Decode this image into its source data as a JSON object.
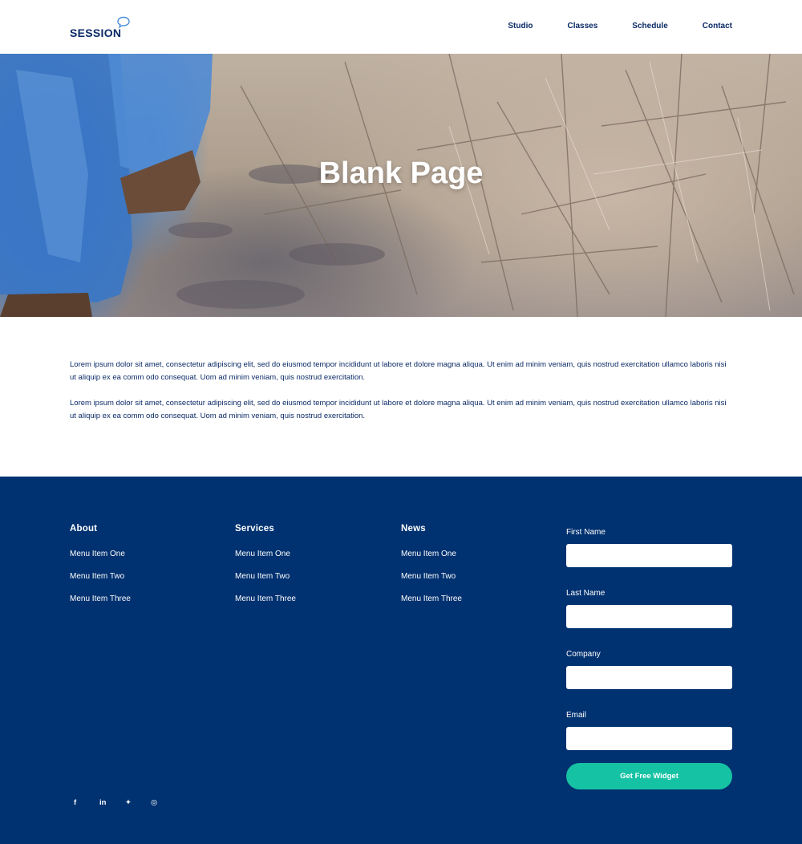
{
  "header": {
    "logo_text": "SESSION",
    "nav": [
      "Studio",
      "Classes",
      "Schedule",
      "Contact"
    ]
  },
  "hero": {
    "title": "Blank Page"
  },
  "content": {
    "paragraphs": [
      "Lorem ipsum dolor sit amet, consectetur adipiscing elit, sed do eiusmod tempor incididunt ut labore et dolore magna aliqua. Ut enim ad minim veniam, quis nostrud exercitation ullamco laboris nisi ut aliquip ex ea comm odo consequat. Uom ad minim veniam, quis nostrud exercitation.",
      "Lorem ipsum dolor sit amet, consectetur adipiscing elit, sed do eiusmod tempor incididunt ut labore et dolore magna aliqua. Ut enim ad minim veniam, quis nostrud exercitation ullamco laboris nisi ut aliquip ex ea comm odo consequat. Uom ad minim veniam, quis nostrud exercitation."
    ]
  },
  "footer": {
    "columns": [
      {
        "title": "About",
        "items": [
          "Menu Item One",
          "Menu Item Two",
          "Menu Item Three"
        ]
      },
      {
        "title": "Services",
        "items": [
          "Menu Item One",
          "Menu Item Two",
          "Menu Item Three"
        ]
      },
      {
        "title": "News",
        "items": [
          "Menu Item One",
          "Menu Item Two",
          "Menu Item Three"
        ]
      }
    ],
    "form": {
      "first_name_label": "First Name",
      "last_name_label": "Last Name",
      "company_label": "Company",
      "email_label": "Email",
      "submit_label": "Get Free Widget"
    },
    "social": [
      {
        "icon": "facebook-icon",
        "glyph": "f"
      },
      {
        "icon": "linkedin-icon",
        "glyph": "in"
      },
      {
        "icon": "twitter-icon",
        "glyph": "✦"
      },
      {
        "icon": "instagram-icon",
        "glyph": "◎"
      }
    ]
  },
  "colors": {
    "brand_navy": "#003170",
    "accent_teal": "#16c2a4",
    "text_navy": "#0a2a66"
  }
}
